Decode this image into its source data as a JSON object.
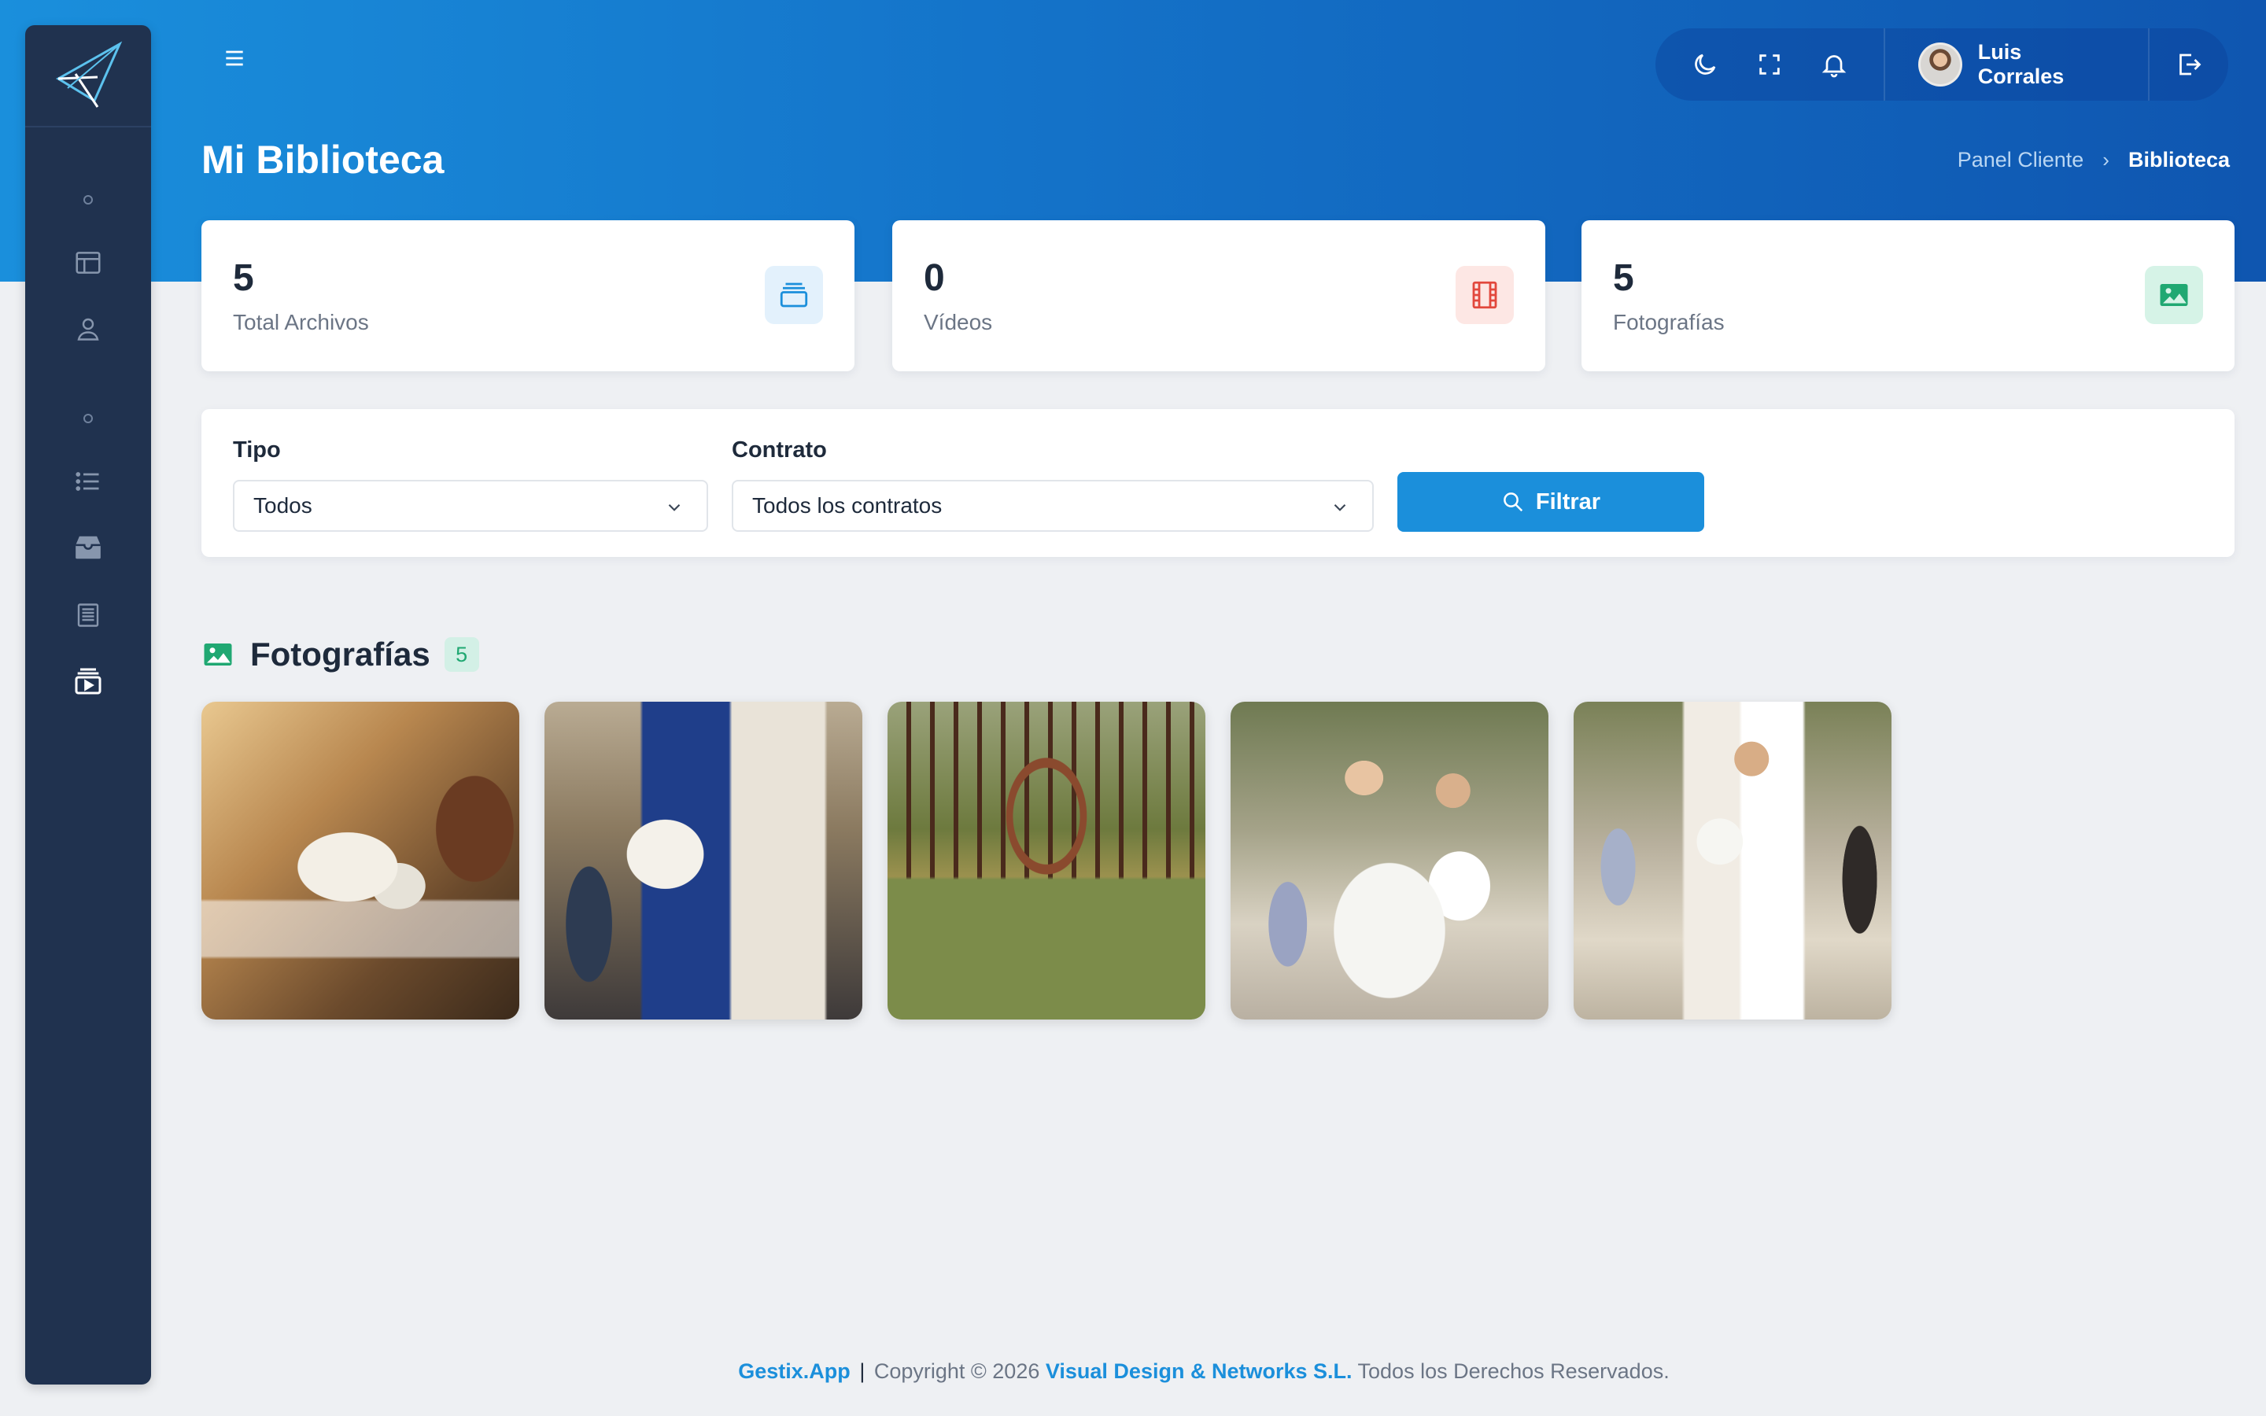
{
  "header": {
    "user_name": "Luis Corrales",
    "page_title": "Mi Biblioteca",
    "breadcrumb": {
      "parent": "Panel Cliente",
      "separator": "›",
      "current": "Biblioteca"
    }
  },
  "stats": [
    {
      "value": "5",
      "label": "Total Archivos",
      "icon": "layers-icon",
      "color": "#1b8fdb",
      "bg": "#e3f1fc"
    },
    {
      "value": "0",
      "label": "Vídeos",
      "icon": "film-icon",
      "color": "#e2483d",
      "bg": "#fde7e4"
    },
    {
      "value": "5",
      "label": "Fotografías",
      "icon": "image-icon",
      "color": "#20a872",
      "bg": "#d6f3e7"
    }
  ],
  "filters": {
    "tipo_label": "Tipo",
    "tipo_value": "Todos",
    "contrato_label": "Contrato",
    "contrato_value": "Todos los contratos",
    "button_label": "Filtrar"
  },
  "gallery": {
    "title": "Fotografías",
    "count": "5",
    "photos": [
      "bouquet-closeup",
      "bride-holding-bouquet",
      "ceremony-arch",
      "couple-celebrating",
      "couple-embracing"
    ]
  },
  "footer": {
    "app": "Gestix.App",
    "separator": "|",
    "copyright": "Copyright © 2026",
    "company": "Visual Design & Networks S.L.",
    "rights": "Todos los Derechos Reservados."
  },
  "colors": {
    "accent": "#1b8fdb",
    "sidebar": "#20324f",
    "header_gradient_start": "#1a8fdc",
    "header_gradient_end": "#0f56b0"
  }
}
